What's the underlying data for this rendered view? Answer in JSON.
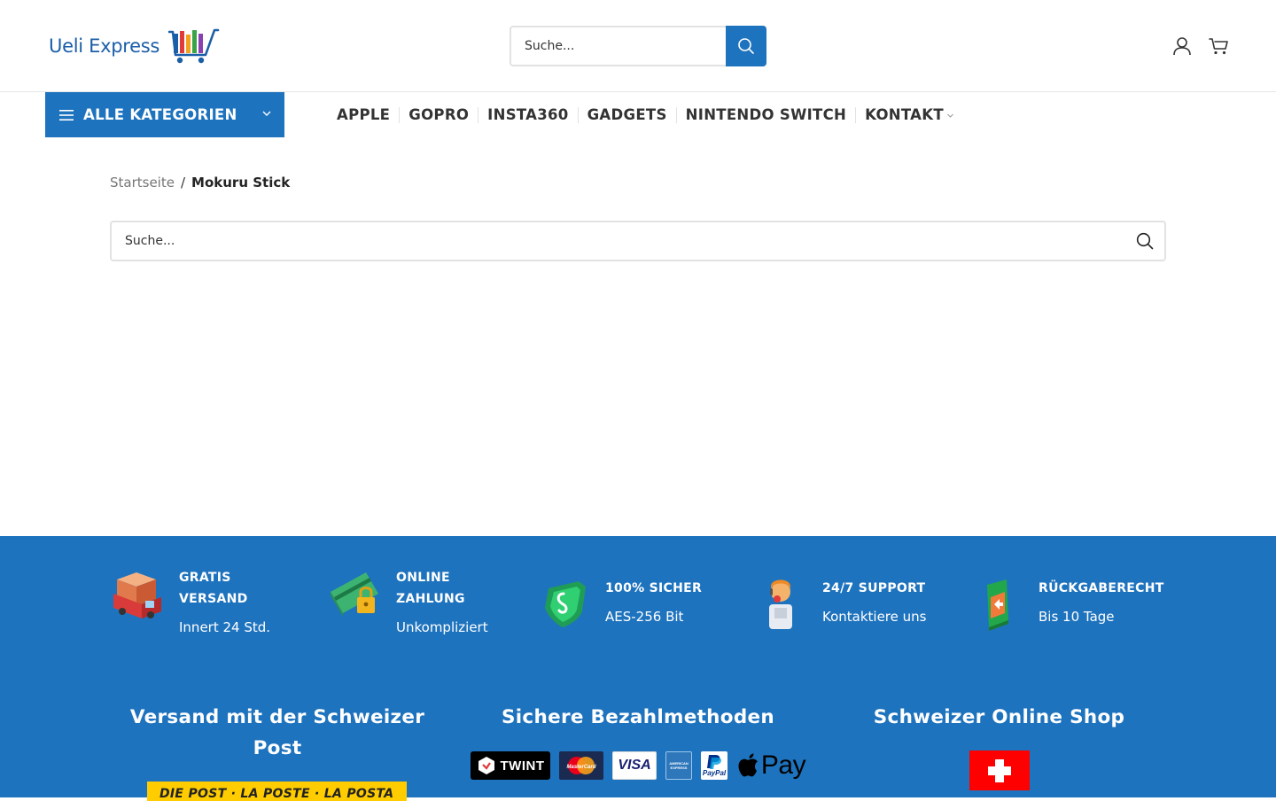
{
  "brand": {
    "name": "Ueli Express"
  },
  "header": {
    "search_placeholder": "Suche...",
    "icons": [
      "user-icon",
      "cart-icon"
    ]
  },
  "nav": {
    "categories_label": "ALLE KATEGORIEN",
    "items": [
      "APPLE",
      "GOPRO",
      "INSTA360",
      "GADGETS",
      "NINTENDO SWITCH",
      "KONTAKT"
    ]
  },
  "breadcrumb": {
    "home": "Startseite",
    "divider": "/",
    "current": "Mokuru Stick"
  },
  "content": {
    "search_placeholder": "Suche..."
  },
  "footer": {
    "features": [
      {
        "title_line1": "GRATIS",
        "title_line2": "VERSAND",
        "subtitle": "Innert 24 Std.",
        "icon": "delivery-truck-icon"
      },
      {
        "title_line1": "ONLINE",
        "title_line2": "ZAHLUNG",
        "subtitle": "Unkompliziert",
        "icon": "credit-card-lock-icon"
      },
      {
        "title_line1": "100% SICHER",
        "title_line2": "",
        "subtitle": "AES-256 Bit",
        "icon": "shield-icon"
      },
      {
        "title_line1": "24/7 SUPPORT",
        "title_line2": "",
        "subtitle": "Kontaktiere uns",
        "icon": "support-agent-icon"
      },
      {
        "title_line1": "RÜCKGABERECHT",
        "title_line2": "",
        "subtitle": "Bis 10 Tage",
        "icon": "return-box-icon"
      }
    ],
    "columns": {
      "shipping_title": "Versand mit der Schweizer Post",
      "shipping_banner": "DIE POST · LA POSTE · LA POSTA",
      "payment_title": "Sichere Bezahlmethoden",
      "payment_methods": [
        "TWINT",
        "MasterCard",
        "VISA",
        "AMERICAN EXPRESS",
        "PayPal",
        "Pay"
      ],
      "shop_title": "Schweizer Online Shop"
    }
  },
  "colors": {
    "primary": "#1e73be",
    "post_yellow": "#ffcc00",
    "swiss_red": "#ff0000"
  }
}
